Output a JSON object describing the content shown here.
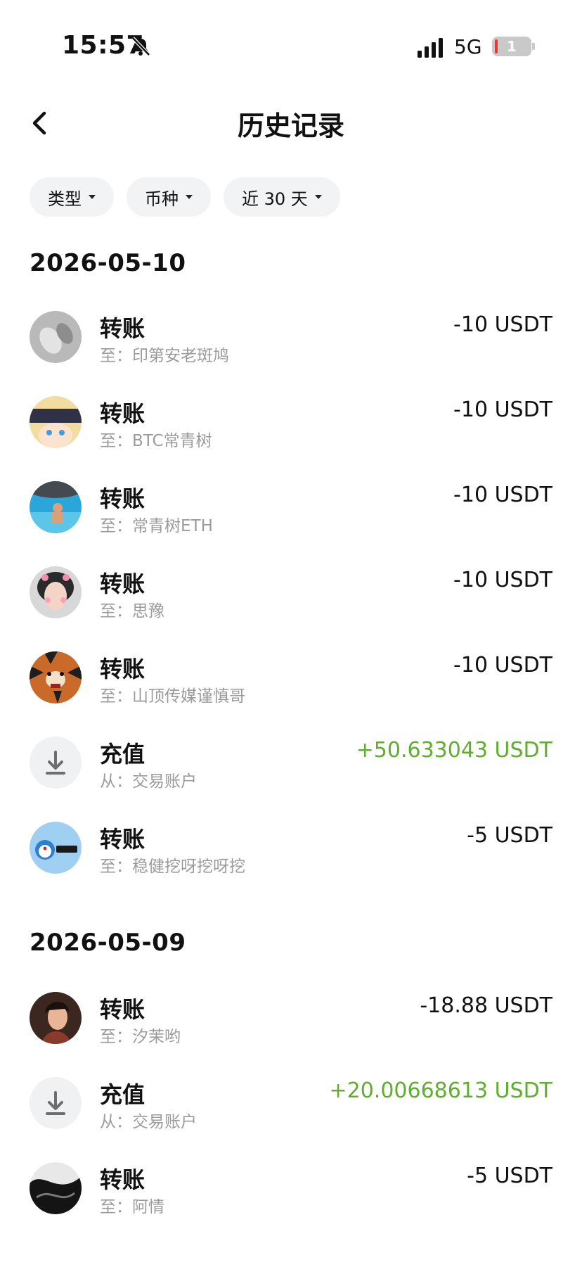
{
  "status_bar": {
    "time": "15:57",
    "network": "5G",
    "battery_level": "1"
  },
  "header": {
    "title": "历史记录"
  },
  "filters": [
    {
      "label": "类型"
    },
    {
      "label": "币种"
    },
    {
      "label": "近 30 天"
    }
  ],
  "sections": [
    {
      "date": "2026-05-10",
      "items": [
        {
          "title": "转账",
          "subtitle": "至：印第安老斑鸠",
          "amount": "-10 USDT"
        },
        {
          "title": "转账",
          "subtitle": "至：BTC常青树",
          "amount": "-10 USDT"
        },
        {
          "title": "转账",
          "subtitle": "至：常青树ETH",
          "amount": "-10 USDT"
        },
        {
          "title": "转账",
          "subtitle": "至：思豫",
          "amount": "-10 USDT"
        },
        {
          "title": "转账",
          "subtitle": "至：山顶传媒谨慎哥",
          "amount": "-10 USDT"
        },
        {
          "title": "充值",
          "subtitle": "从：交易账户",
          "amount": "+50.633043 USDT"
        },
        {
          "title": "转账",
          "subtitle": "至：稳健挖呀挖呀挖",
          "amount": "-5 USDT"
        }
      ]
    },
    {
      "date": "2026-05-09",
      "items": [
        {
          "title": "转账",
          "subtitle": "至：汐茉哟",
          "amount": "-18.88 USDT"
        },
        {
          "title": "充值",
          "subtitle": "从：交易账户",
          "amount": "+20.00668613 USDT"
        },
        {
          "title": "转账",
          "subtitle": "至：阿情",
          "amount": "-5 USDT"
        }
      ]
    }
  ],
  "colors": {
    "positive": "#5fae2e",
    "muted": "#9b9b9b",
    "chip_bg": "#f2f3f5"
  }
}
